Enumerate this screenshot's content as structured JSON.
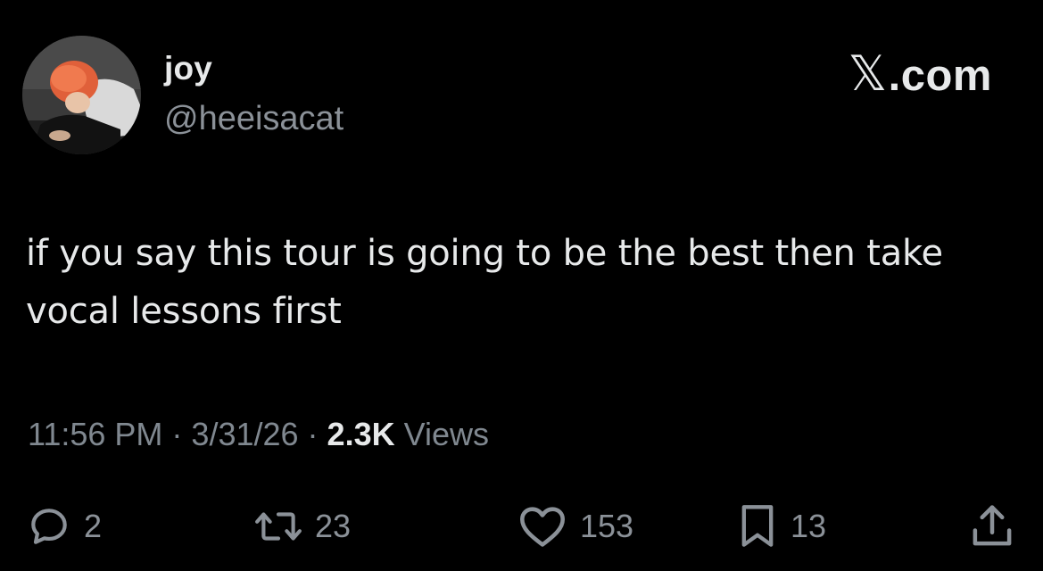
{
  "tweet": {
    "author": {
      "display_name": "joy",
      "handle": "@heeisacat",
      "avatar": "user-avatar-photo"
    },
    "brand": {
      "x_glyph": "𝕏",
      "suffix": ".com"
    },
    "text": "if you say this tour is going to be the best then take vocal lessons first",
    "meta": {
      "time": "11:56 PM",
      "separator": "·",
      "date": "3/31/26",
      "views_count": "2.3K",
      "views_label": "Views"
    },
    "actions": {
      "reply": {
        "icon": "reply-icon",
        "count": "2"
      },
      "retweet": {
        "icon": "retweet-icon",
        "count": "23"
      },
      "like": {
        "icon": "heart-icon",
        "count": "153"
      },
      "bookmark": {
        "icon": "bookmark-icon",
        "count": "13"
      },
      "share": {
        "icon": "share-icon"
      }
    }
  },
  "colors": {
    "background": "#000000",
    "primary_text": "#e7e9ea",
    "secondary_text": "#8b9198"
  }
}
